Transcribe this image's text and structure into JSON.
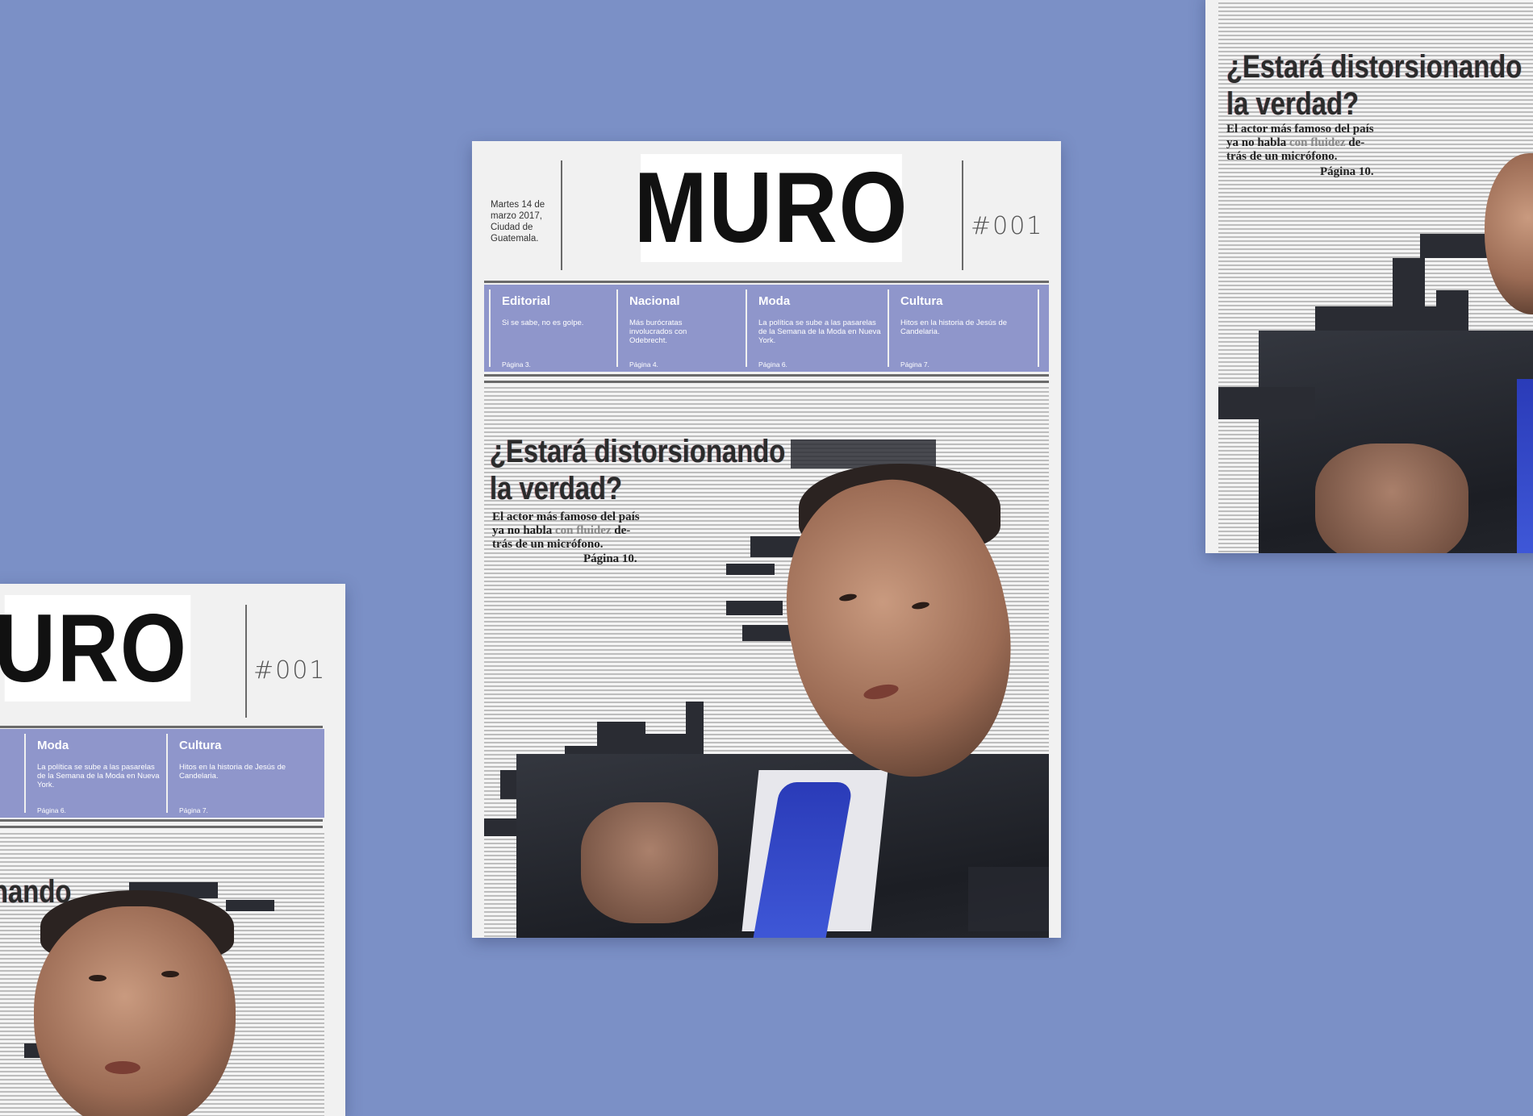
{
  "masthead": "MURO",
  "masthead_partial": "URO",
  "dateline": [
    "Martes 14 de",
    "marzo 2017,",
    "Ciudad de",
    "Guatemala."
  ],
  "issue": "#001",
  "sections": [
    {
      "title": "Editorial",
      "desc": "Si se sabe, no es golpe.",
      "page": "Página 3."
    },
    {
      "title": "Nacional",
      "desc": "Más burócratas involucrados con Odebrecht.",
      "page": "Página 4."
    },
    {
      "title": "Moda",
      "desc": "La política se sube a las pasarelas de la Semana de la Moda en Nueva York.",
      "page": "Página 6."
    },
    {
      "title": "Cultura",
      "desc": "Hitos en la historia de Jesús de Candelaria.",
      "page": "Página 7."
    }
  ],
  "headline": {
    "line1": "¿Estará distorsionando",
    "line2": "la verdad?",
    "fragment": "nando"
  },
  "subhead": {
    "line1": "El actor más famoso del país",
    "line2_a": "ya no habla ",
    "line2_b": "con fluidez",
    "line2_c": " de-",
    "line3": "trás de un micrófono.",
    "page": "Página 10."
  },
  "subhead_right": {
    "line2_c": " detrás de un micrófono."
  },
  "colors": {
    "background": "#7b90c6",
    "section_bar": "#8f96cb",
    "tie": "#3a52d0"
  }
}
